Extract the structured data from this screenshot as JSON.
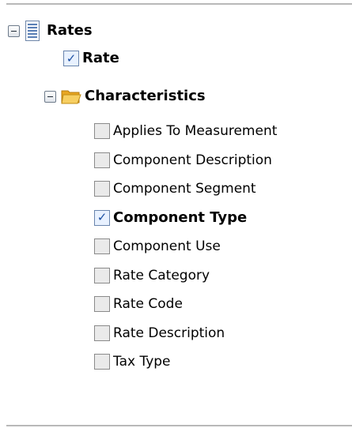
{
  "tree": {
    "root": {
      "label": "Rates",
      "expanded_icon": "collapse-minus-icon",
      "icon": "document-icon"
    },
    "rate": {
      "label": "Rate",
      "checked": true
    },
    "characteristics": {
      "label": "Characteristics",
      "expanded_icon": "collapse-minus-icon",
      "icon": "open-folder-icon",
      "items": [
        {
          "label": "Applies To Measurement",
          "checked": false
        },
        {
          "label": "Component Description",
          "checked": false
        },
        {
          "label": "Component Segment",
          "checked": false
        },
        {
          "label": "Component Type",
          "checked": true
        },
        {
          "label": "Component Use",
          "checked": false
        },
        {
          "label": "Rate Category",
          "checked": false
        },
        {
          "label": "Rate Code",
          "checked": false
        },
        {
          "label": "Rate Description",
          "checked": false
        },
        {
          "label": "Tax Type",
          "checked": false
        }
      ]
    }
  },
  "colors": {
    "check_mark": "#1b4fa3",
    "folder": "#f2b632",
    "document_lines": "#5a7fb5"
  }
}
